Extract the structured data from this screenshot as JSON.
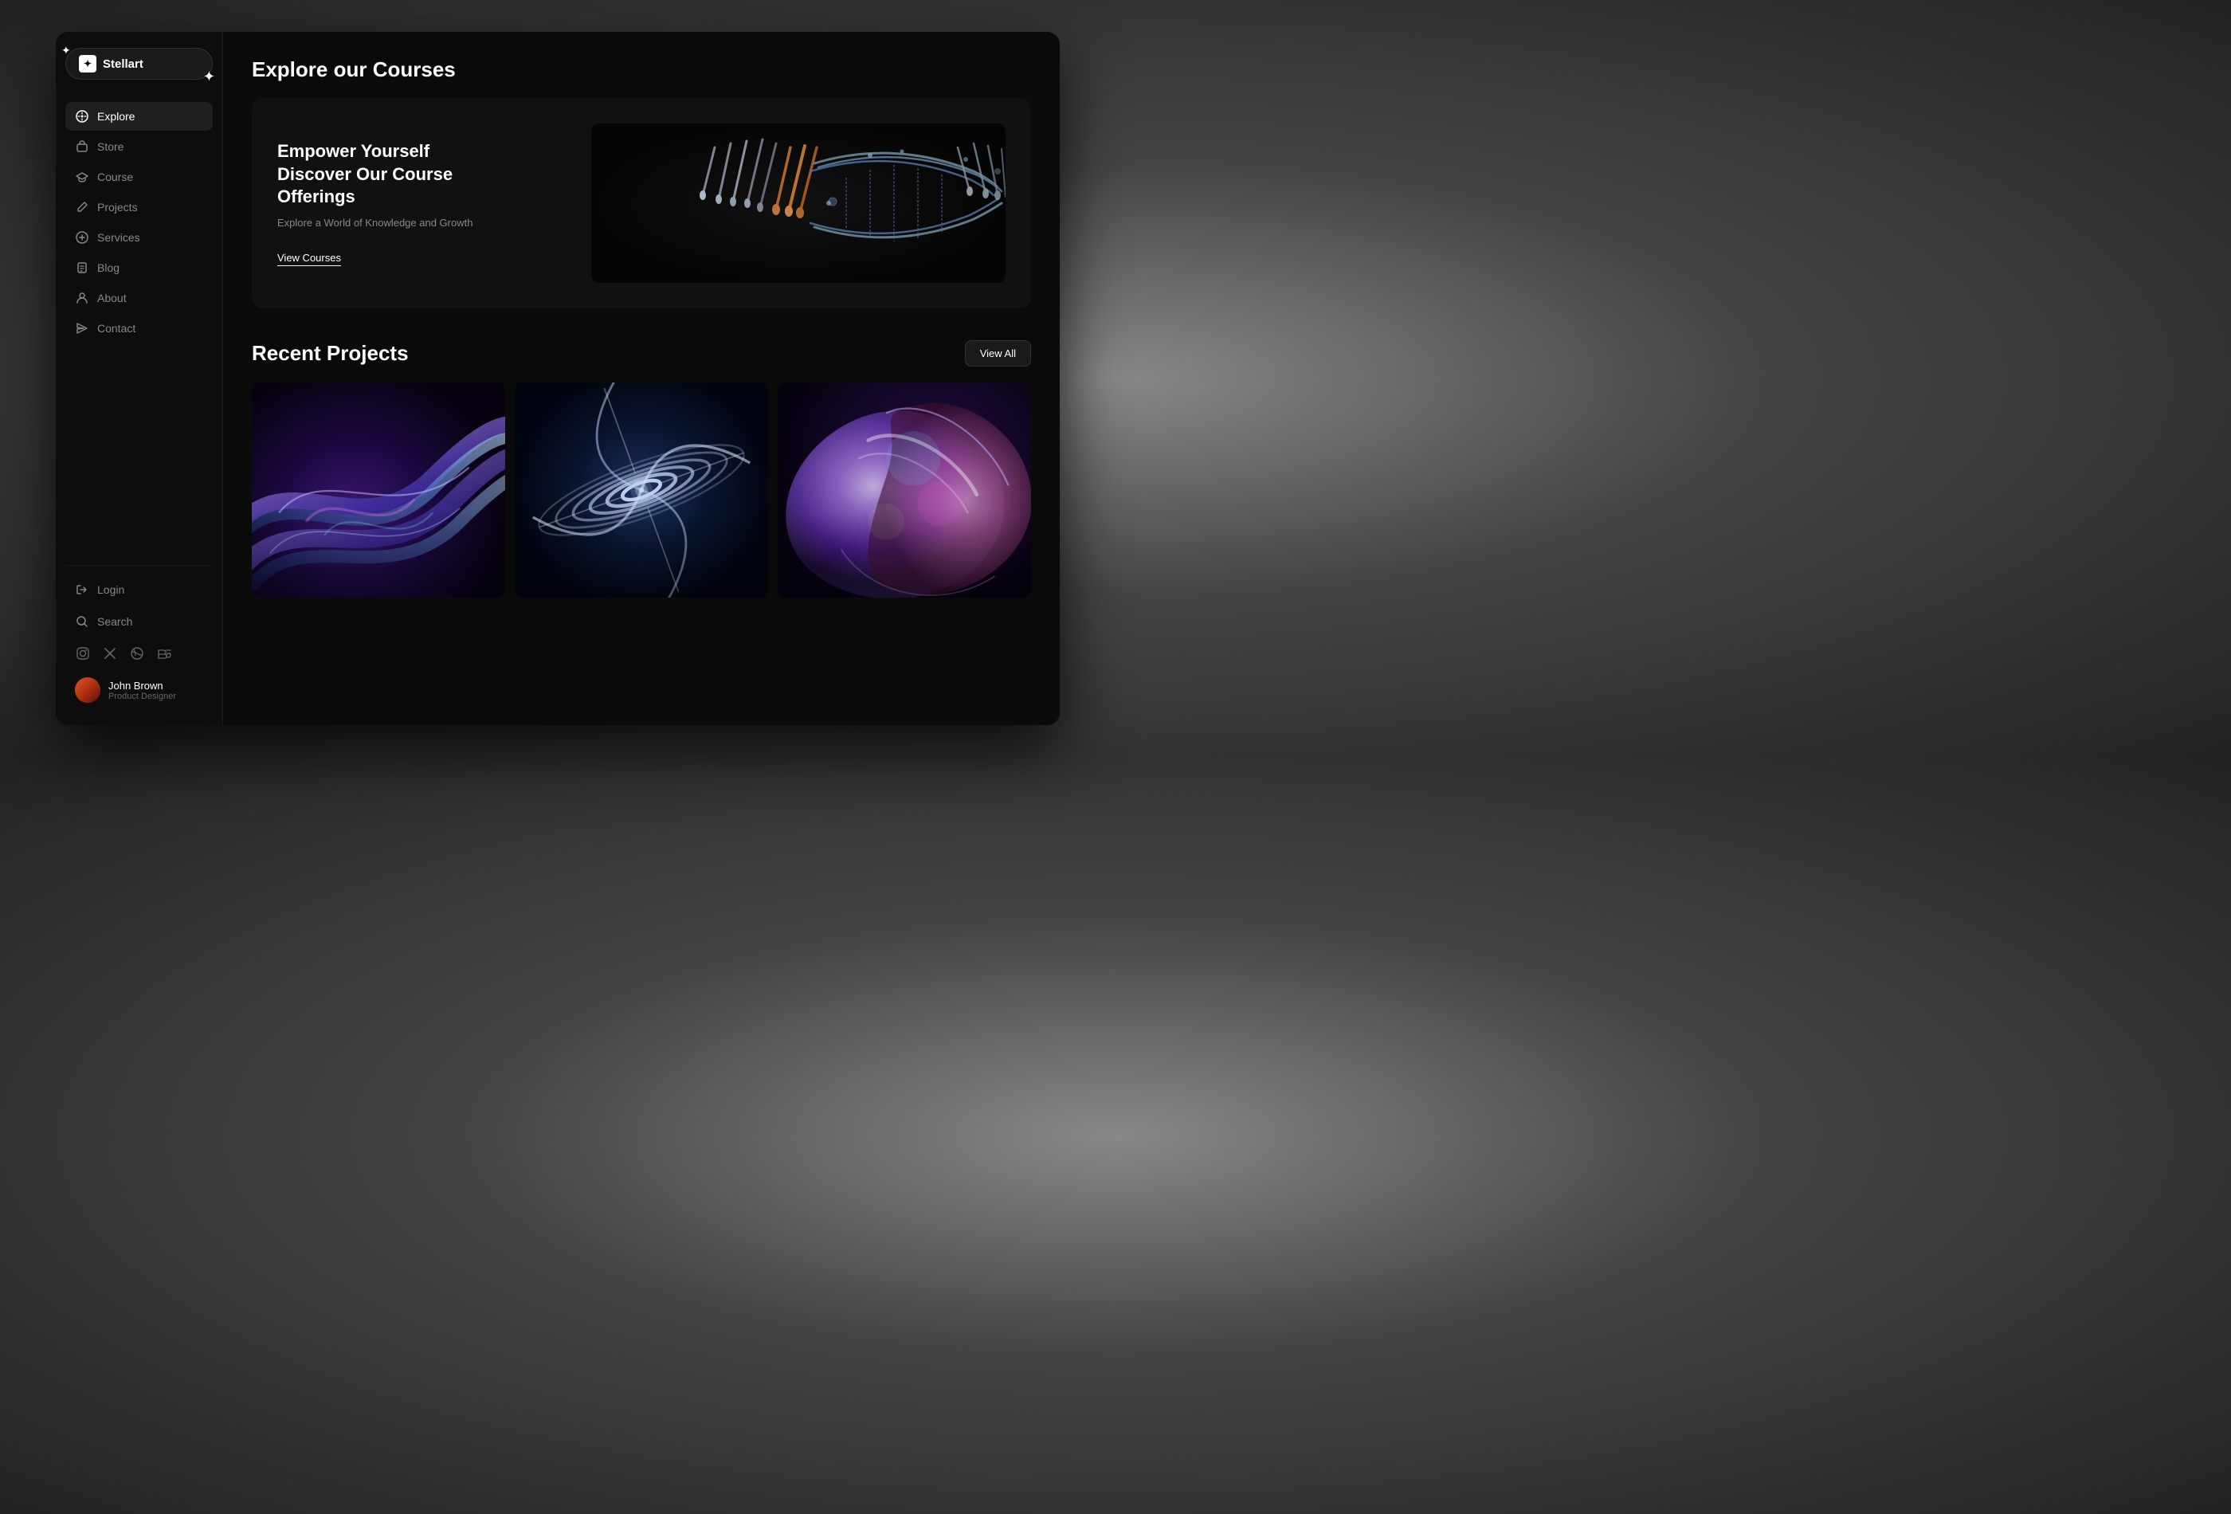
{
  "app": {
    "name": "Stellart",
    "logo_icon": "✦"
  },
  "sidebar": {
    "nav_items": [
      {
        "id": "explore",
        "label": "Explore",
        "icon": "compass",
        "active": true
      },
      {
        "id": "store",
        "label": "Store",
        "icon": "bag"
      },
      {
        "id": "course",
        "label": "Course",
        "icon": "graduation"
      },
      {
        "id": "projects",
        "label": "Projects",
        "icon": "pencil"
      },
      {
        "id": "services",
        "label": "Services",
        "icon": "plus-circle"
      },
      {
        "id": "blog",
        "label": "Blog",
        "icon": "document"
      },
      {
        "id": "about",
        "label": "About",
        "icon": "person"
      },
      {
        "id": "contact",
        "label": "Contact",
        "icon": "send"
      }
    ],
    "bottom_items": [
      {
        "id": "login",
        "label": "Login",
        "icon": "login"
      },
      {
        "id": "search",
        "label": "Search",
        "icon": "search"
      }
    ],
    "social_icons": [
      "instagram",
      "twitter",
      "dribbble",
      "behance"
    ],
    "user": {
      "name": "John Brown",
      "role": "Product Designer"
    }
  },
  "main": {
    "courses_section": {
      "title": "Explore our Courses",
      "hero": {
        "title": "Empower Yourself Discover Our Course Offerings",
        "subtitle": "Explore a World of Knowledge and Growth",
        "cta_label": "View Courses"
      }
    },
    "projects_section": {
      "title": "Recent Projects",
      "view_all_label": "View All"
    }
  }
}
